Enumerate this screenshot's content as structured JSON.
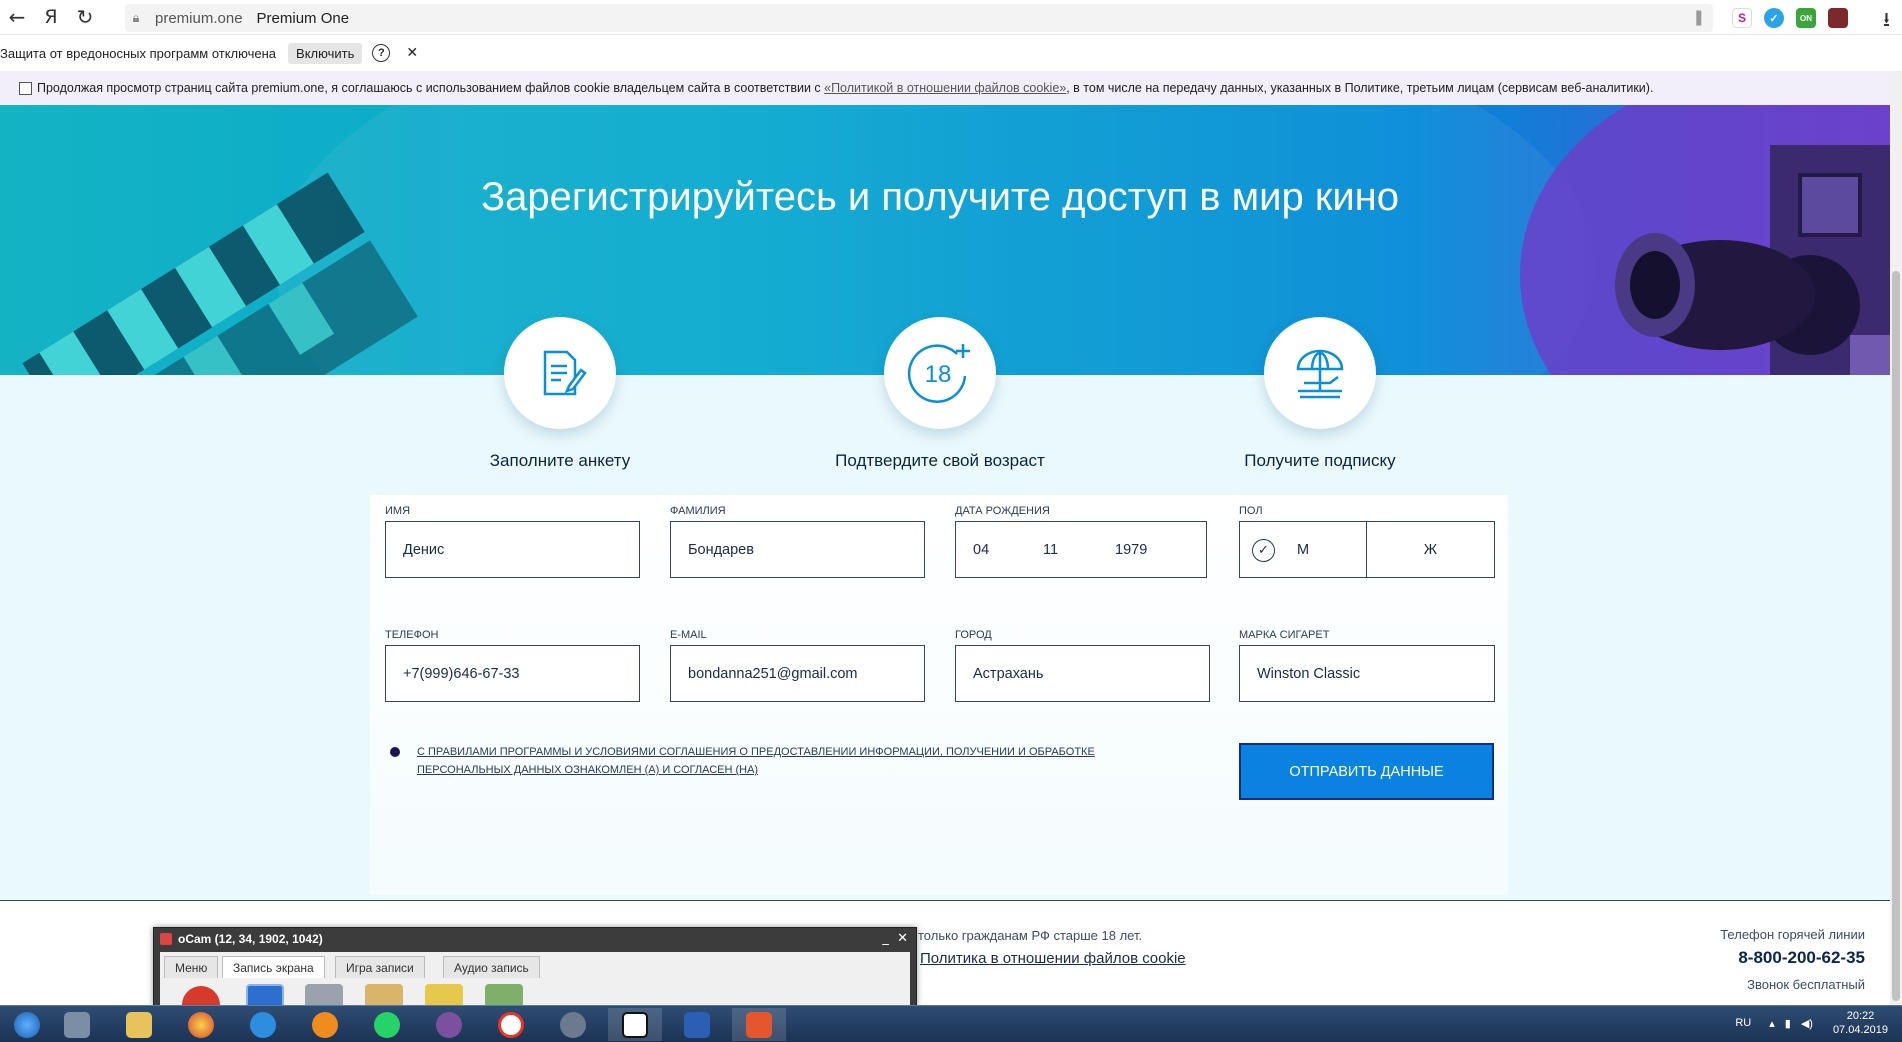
{
  "browser": {
    "host": "premium.one",
    "title": "Premium One",
    "yandex_glyph": "Я"
  },
  "protection": {
    "text": "Защита от вредоносных программ отключена",
    "enable_label": "Включить",
    "help_glyph": "?",
    "close_glyph": "✕"
  },
  "cookie": {
    "prefix": "Продолжая просмотр страниц сайта premium.one, я соглашаюсь с использованием файлов cookie владельцем сайта в соответствии с ",
    "link": "«Политикой в отношении файлов cookie»",
    "suffix": ", в том числе на передачу данных, указанных в Политике, третьим лицам (сервисам веб-аналитики)."
  },
  "hero": {
    "headline": "Зарегистрируйтесь и получите доступ в мир кино"
  },
  "steps": [
    {
      "label": "Заполните анкету",
      "icon": "form-icon"
    },
    {
      "label": "Подтвердите свой возраст",
      "icon": "age-18-plus-icon",
      "badge": "18"
    },
    {
      "label": "Получите подписку",
      "icon": "beach-umbrella-icon"
    }
  ],
  "form": {
    "name": {
      "label": "ИМЯ",
      "value": "Денис"
    },
    "surname": {
      "label": "ФАМИЛИЯ",
      "value": "Бондарев"
    },
    "birthdate": {
      "label": "ДАТА РОЖДЕНИЯ",
      "day": "04",
      "month": "11",
      "year": "1979"
    },
    "gender": {
      "label": "ПОЛ",
      "male": "М",
      "female": "Ж",
      "selected": "М"
    },
    "phone": {
      "label": "ТЕЛЕФОН",
      "value": "+7(999)646-67-33"
    },
    "email": {
      "label": "E-MAIL",
      "value": "bondanna251@gmail.com"
    },
    "city": {
      "label": "ГОРОД",
      "value": "Астрахань"
    },
    "brand": {
      "label": "МАРКА СИГАРЕТ",
      "value": "Winston Classic"
    },
    "agreement": "С ПРАВИЛАМИ ПРОГРАММЫ И УСЛОВИЯМИ СОГЛАШЕНИЯ О ПРЕДОСТАВЛЕНИИ ИНФОРМАЦИИ, ПОЛУЧЕНИИ И ОБРАБОТКЕ ПЕРСОНАЛЬНЫХ ДАННЫХ ОЗНАКОМЛЕН (А) И СОГЛАСЕН (НА)",
    "submit": "ОТПРАВИТЬ ДАННЫЕ"
  },
  "footer": {
    "age_note": "только гражданам РФ старше 18 лет.",
    "policy_link": "Политика в отношении файлов cookie",
    "hotline_label": "Телефон горячей линии",
    "hotline_number": "8-800-200-62-35",
    "free_call": "Звонок бесплатный"
  },
  "ocam": {
    "title": "oCam (12, 34, 1902, 1042)",
    "tabs": [
      "Меню",
      "Запись экрана",
      "Игра записи",
      "Аудио запись"
    ],
    "active_tab": "Запись экрана"
  },
  "taskbar": {
    "lang": "RU",
    "time": "20:22",
    "date": "07.04.2019"
  },
  "colors": {
    "accent": "#0a83e0",
    "hero_start": "#14b3c4",
    "hero_end": "#7a4bd3",
    "text_dark": "#1b2b45"
  }
}
